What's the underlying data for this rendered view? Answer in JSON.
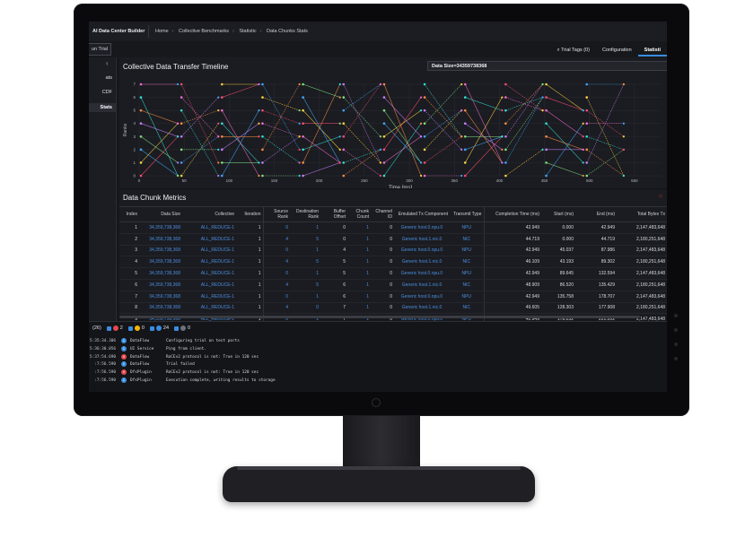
{
  "app": {
    "brand": "AI Data Center Builder",
    "breadcrumb": [
      "Home",
      "Collective Benchmarks",
      "Statistic",
      "Data Chunks Stats"
    ],
    "run_button": "un Trial",
    "tabs": [
      "Trial Tags (0)",
      "Configuration",
      "Statisti"
    ]
  },
  "leftnav": {
    "items": [
      "ats",
      "CDF",
      "Stats"
    ]
  },
  "timeline": {
    "title": "Collective Data Transfer Timeline",
    "data_size_select": "Data Size=34359738368",
    "ylabel": "Ranks",
    "xlabel": "Time [ms]",
    "x_ticks": [
      0,
      50,
      100,
      150,
      200,
      250,
      300,
      350,
      400,
      450,
      500,
      550
    ],
    "y_ticks": [
      0,
      1,
      2,
      3,
      4,
      5,
      6,
      7
    ],
    "colors": [
      "#ff4d6d",
      "#ffd23f",
      "#3ea7ff",
      "#7ee081",
      "#c77dff",
      "#ff8c42",
      "#33e0d5",
      "#f06bd0"
    ]
  },
  "metrics": {
    "title": "Data Chunk Metrics",
    "close_icon": "close-icon",
    "columns": [
      "Index",
      "Data Size",
      "Collective",
      "Iteration",
      "Source Rank",
      "Destination Rank",
      "Buffer Offset",
      "Chunk Count",
      "Channel ID",
      "Emulated Tx Component",
      "Transmit Type",
      "Completion Time (ms)",
      "Start (ms)",
      "End (ms)",
      "Total Bytes Tx"
    ],
    "rows": [
      [
        "1",
        "34,359,738,368",
        "ALL_REDUCE-1",
        "1",
        "0",
        "1",
        "0",
        "1",
        "0",
        "Generic host.0.npu.0",
        "NPU",
        "42.949",
        "0.000",
        "42.949",
        "2,147,483,648"
      ],
      [
        "2",
        "34,359,738,368",
        "ALL_REDUCE-1",
        "1",
        "4",
        "5",
        "0",
        "1",
        "0",
        "Generic host.1.nic.0",
        "NIC",
        "44.719",
        "0.000",
        "44.719",
        "2,180,251,648"
      ],
      [
        "3",
        "34,359,738,368",
        "ALL_REDUCE-1",
        "1",
        "0",
        "1",
        "4",
        "1",
        "0",
        "Generic host.0.npu.0",
        "NPU",
        "42.949",
        "45.037",
        "87.986",
        "2,147,483,648"
      ],
      [
        "4",
        "34,359,738,368",
        "ALL_REDUCE-1",
        "1",
        "4",
        "5",
        "5",
        "1",
        "0",
        "Generic host.1.nic.0",
        "NIC",
        "46.109",
        "43.193",
        "89.302",
        "2,180,251,648"
      ],
      [
        "5",
        "34,359,738,368",
        "ALL_REDUCE-1",
        "1",
        "0",
        "1",
        "5",
        "1",
        "0",
        "Generic host.0.npu.0",
        "NPU",
        "42.949",
        "89.645",
        "132.594",
        "2,147,483,648"
      ],
      [
        "6",
        "34,359,738,368",
        "ALL_REDUCE-1",
        "1",
        "4",
        "5",
        "6",
        "1",
        "0",
        "Generic host.1.nic.0",
        "NIC",
        "48.909",
        "86.520",
        "135.429",
        "2,180,251,648"
      ],
      [
        "7",
        "34,359,738,368",
        "ALL_REDUCE-1",
        "1",
        "0",
        "1",
        "6",
        "1",
        "0",
        "Generic host.0.npu.0",
        "NPU",
        "42.949",
        "135.758",
        "178.707",
        "2,147,483,648"
      ],
      [
        "8",
        "34,359,738,368",
        "ALL_REDUCE-1",
        "1",
        "4",
        "0",
        "7",
        "1",
        "0",
        "Generic host.1.nic.0",
        "NIC",
        "49.605",
        "128.303",
        "177.908",
        "2,180,251,648"
      ],
      [
        "9",
        "34,359,738,368",
        "ALL_REDUCE-1",
        "1",
        "0",
        "1",
        "7",
        "1",
        "0",
        "Generic host.0.npu.0",
        "NPU",
        "42.949",
        "178.252",
        "221.202",
        "2,147,483,648"
      ]
    ]
  },
  "log": {
    "count": "(26)",
    "filters": [
      {
        "icon": "error-icon",
        "count": "2",
        "color": "#e5484d"
      },
      {
        "icon": "warning-icon",
        "count": "0",
        "color": "#f5b400"
      },
      {
        "icon": "info-icon",
        "count": "24",
        "color": "#3a8de0"
      },
      {
        "icon": "debug-icon",
        "count": "0",
        "color": "#6b7280"
      }
    ],
    "rows": [
      {
        "time": "5:35:34.306",
        "level": "info",
        "source": "DataFlow",
        "message": "Configuring trial on test ports"
      },
      {
        "time": "5:36:30.056",
        "level": "info",
        "source": "UI Service",
        "message": "Ping from client."
      },
      {
        "time": "5:37:54.690",
        "level": "error",
        "source": "DataFlow",
        "message": "RoCEv2 protocol is not: True in 120 sec"
      },
      {
        "time": ":7:56.590",
        "level": "info",
        "source": "DataFlow",
        "message": "Trial failed"
      },
      {
        "time": ":7:56.590",
        "level": "error",
        "source": "DfsPlugin",
        "message": "RoCEv2 protocol is not: True in 120 sec"
      },
      {
        "time": ":7:56.590",
        "level": "info",
        "source": "DfsPlugin",
        "message": "Execution complete, writing results to storage"
      }
    ]
  }
}
